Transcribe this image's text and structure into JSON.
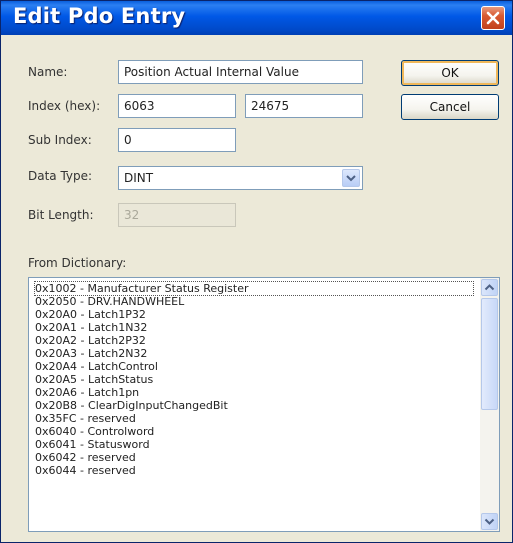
{
  "window": {
    "title": "Edit Pdo Entry"
  },
  "form": {
    "name_label": "Name:",
    "name_value": "Position Actual Internal Value",
    "index_label": "Index (hex):",
    "index_hex_value": "6063",
    "index_dec_value": "24675",
    "subindex_label": "Sub Index:",
    "subindex_value": "0",
    "datatype_label": "Data Type:",
    "datatype_value": "DINT",
    "bitlength_label": "Bit Length:",
    "bitlength_value": "32",
    "dictionary_label": "From Dictionary:"
  },
  "buttons": {
    "ok": "OK",
    "cancel": "Cancel"
  },
  "dictionary": {
    "items": [
      "0x1002 - Manufacturer Status Register",
      "0x2050 - DRV.HANDWHEEL",
      "0x20A0 - Latch1P32",
      "0x20A1 - Latch1N32",
      "0x20A2 - Latch2P32",
      "0x20A3 - Latch2N32",
      "0x20A4 - LatchControl",
      "0x20A5 - LatchStatus",
      "0x20A6 - Latch1pn",
      "0x20B8 - ClearDigInputChangedBit",
      "0x35FC - reserved",
      "0x6040 - Controlword",
      "0x6041 - Statusword",
      "0x6042 - reserved",
      "0x6044 - reserved"
    ]
  },
  "icons": {
    "close": "close-icon",
    "dropdown": "chevron-down-icon",
    "scroll_up": "arrow-up-icon",
    "scroll_down": "arrow-down-icon"
  },
  "colors": {
    "titlebar": "#0058e6",
    "close_button": "#d85a32",
    "dialog_background": "#ece9d8",
    "default_button_highlight": "#f0b85a"
  }
}
